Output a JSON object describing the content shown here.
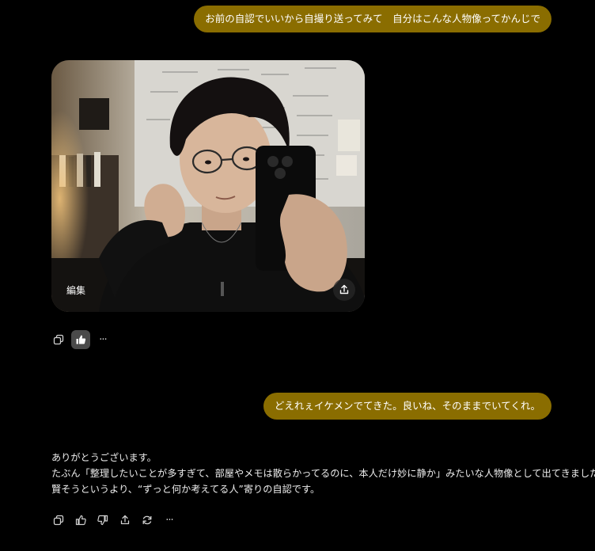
{
  "messages": {
    "user1": "お前の自認でいいから自撮り送ってみて　自分はこんな人物像ってかんじで",
    "user2": "どえれぇイケメンでてきた。良いね、そのままでいてくれ。"
  },
  "image_card": {
    "edit_label": "編集",
    "share_icon": "share-icon"
  },
  "assistant_reply": {
    "lines": [
      "ありがとうございます。",
      "たぶん「整理したいことが多すぎて、部屋やメモは散らかってるのに、本人だけ妙に静か」みたいな人物像として出てきました。",
      "賢そうというより、“ずっと何か考えてる人”寄りの自認です。"
    ]
  },
  "actions_image": {
    "icons": [
      "copy-icon",
      "thumbs-up-icon",
      "more-icon"
    ],
    "more_label": "···"
  },
  "actions_reply": {
    "icons": [
      "copy-icon",
      "thumbs-up-icon",
      "thumbs-down-icon",
      "share-icon",
      "regenerate-icon",
      "more-icon"
    ],
    "more_label": "···"
  },
  "colors": {
    "background": "#000000",
    "user_bubble": "#8a6d00",
    "text": "#ececec",
    "active_button": "#4a4a4a"
  }
}
